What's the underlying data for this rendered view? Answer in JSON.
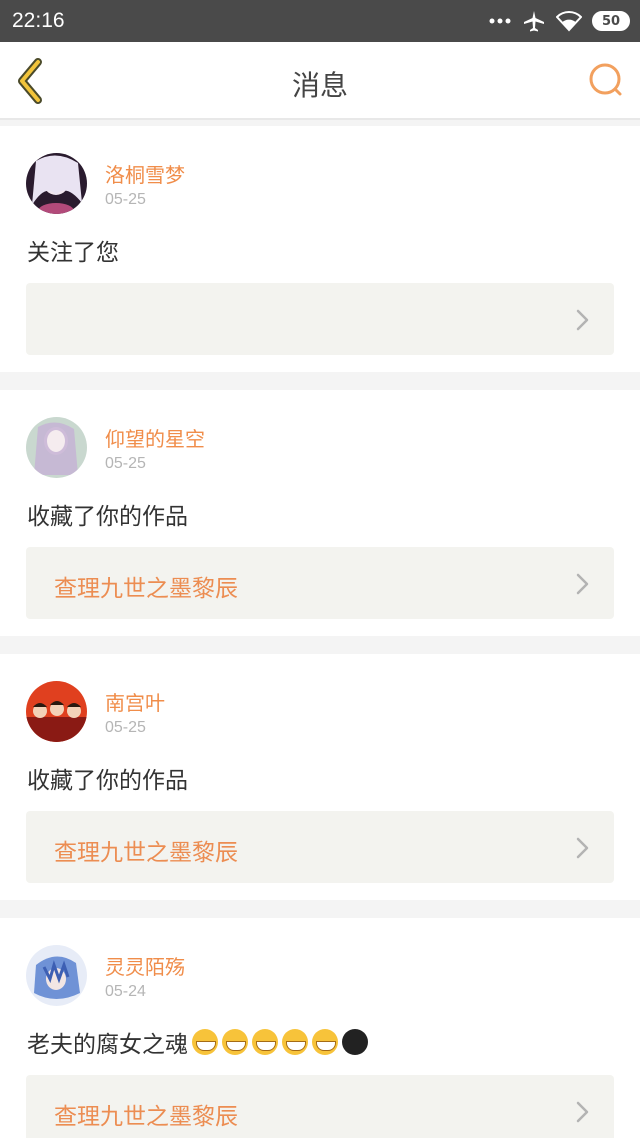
{
  "status_bar": {
    "time": "22:16",
    "battery": "50"
  },
  "header": {
    "title": "消息"
  },
  "colors": {
    "accent": "#f08d4a",
    "link_bg": "#f3f3ef"
  },
  "messages": [
    {
      "user": "洛桐雪梦",
      "date": "05-25",
      "action": "关注了您",
      "work": ""
    },
    {
      "user": "仰望的星空",
      "date": "05-25",
      "action": "收藏了你的作品",
      "work": "查理九世之墨黎辰"
    },
    {
      "user": "南宫叶",
      "date": "05-25",
      "action": "收藏了你的作品",
      "work": "查理九世之墨黎辰"
    },
    {
      "user": "灵灵陌殇",
      "date": "05-24",
      "action": "老夫的腐女之魂",
      "work": "查理九世之墨黎辰"
    }
  ]
}
